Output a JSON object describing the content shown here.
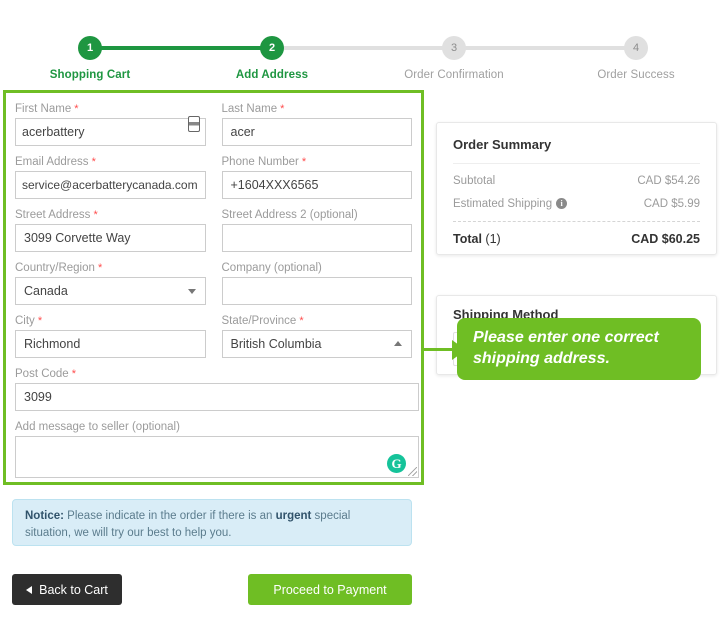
{
  "stepper": {
    "steps": [
      {
        "number": "1",
        "label": "Shopping Cart",
        "state": "done"
      },
      {
        "number": "2",
        "label": "Add Address",
        "state": "active"
      },
      {
        "number": "3",
        "label": "Order Confirmation",
        "state": "todo"
      },
      {
        "number": "4",
        "label": "Order Success",
        "state": "todo"
      }
    ],
    "active_color": "#1e9641",
    "inactive_color": "#e0e0e0"
  },
  "form": {
    "border_color": "#6fbe24",
    "fields": {
      "first_name": {
        "label": "First Name",
        "required": true,
        "value": "acerbattery",
        "icon": "contact-card-icon"
      },
      "last_name": {
        "label": "Last Name",
        "required": true,
        "value": "acer"
      },
      "email": {
        "label": "Email Address",
        "required": true,
        "value": "service@acerbatterycanada.com"
      },
      "phone": {
        "label": "Phone Number",
        "required": true,
        "value": "+1604XXX6565"
      },
      "street_address": {
        "label": "Street Address",
        "required": true,
        "value": "3099 Corvette Way"
      },
      "street_address2": {
        "label": "Street Address 2 (optional)",
        "required": false,
        "value": ""
      },
      "country": {
        "label": "Country/Region",
        "required": true,
        "value": "Canada",
        "caret": "chevron-down"
      },
      "company": {
        "label": "Company (optional)",
        "required": false,
        "value": ""
      },
      "city": {
        "label": "City",
        "required": true,
        "value": "Richmond"
      },
      "state": {
        "label": "State/Province",
        "required": true,
        "value": "British Columbia",
        "caret": "chevron-up"
      },
      "post_code": {
        "label": "Post Code",
        "required": true,
        "value": "3099"
      },
      "message": {
        "label": "Add message to seller (optional)",
        "required": false,
        "value": "",
        "icon": "grammarly-icon",
        "icon_glyph": "G"
      }
    }
  },
  "order_summary": {
    "title": "Order Summary",
    "rows": [
      {
        "label": "Subtotal",
        "value": "CAD $54.26",
        "info": false
      },
      {
        "label": "Estimated Shipping",
        "value": "CAD $5.99",
        "info": true
      }
    ],
    "total": {
      "label_bold": "Total",
      "label_rest": " (1)",
      "value": "CAD $60.25"
    }
  },
  "shipping_method": {
    "title": "Shipping Method"
  },
  "tooltip": {
    "text": "Please enter one correct shipping address.",
    "color": "#6fbe24"
  },
  "notice": {
    "prefix": "Notice:",
    "text_before": " Please indicate in the order if there is an ",
    "emphasis": "urgent",
    "text_after": " special situation, we will try our best to help you.",
    "background": "#d9edf7"
  },
  "buttons": {
    "back": {
      "label": "Back to Cart",
      "color": "#2e2e2e"
    },
    "proceed": {
      "label": "Proceed to Payment",
      "color": "#6fbe24"
    }
  }
}
